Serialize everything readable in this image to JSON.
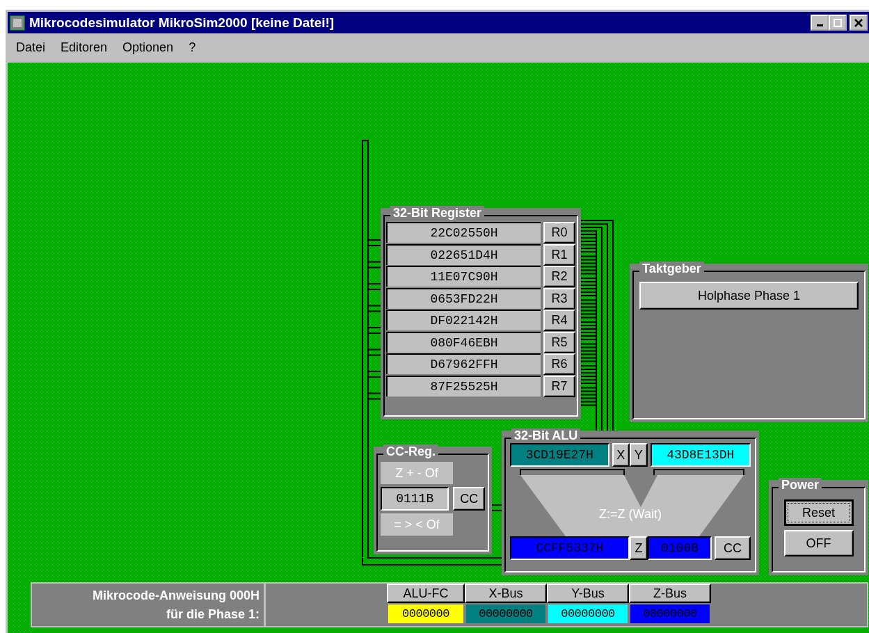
{
  "window": {
    "title": "Mikrocodesimulator MikroSim2000 [keine Datei!]"
  },
  "menu": [
    {
      "label": "Datei"
    },
    {
      "label": "Editoren"
    },
    {
      "label": "Optionen"
    },
    {
      "label": "?"
    }
  ],
  "registers": {
    "title": "32-Bit Register",
    "rows": [
      {
        "value": "22C02550H",
        "label": "R0"
      },
      {
        "value": "022651D4H",
        "label": "R1"
      },
      {
        "value": "11E07C90H",
        "label": "R2"
      },
      {
        "value": "0653FD22H",
        "label": "R3"
      },
      {
        "value": "DF022142H",
        "label": "R4"
      },
      {
        "value": "080F46EBH",
        "label": "R5"
      },
      {
        "value": "D67962FFH",
        "label": "R6"
      },
      {
        "value": "87F25525H",
        "label": "R7"
      }
    ]
  },
  "clock": {
    "title": "Taktgeber",
    "button": "Holphase Phase 1"
  },
  "cc_reg": {
    "title": "CC-Reg.",
    "flags_top": "Z + - Of",
    "value": "0111B",
    "button": "CC",
    "flags_bottom": "= > < Of"
  },
  "alu": {
    "title": "32-Bit ALU",
    "x_value": {
      "text": "3CD19E27H",
      "color": "#008080"
    },
    "x_button": "X",
    "y_button": "Y",
    "y_value": {
      "text": "43D8E13DH",
      "color": "#00ffff"
    },
    "operation": "Z:=Z (Wait)",
    "z_value": {
      "text": "CCFF5337H",
      "color": "#0000ff"
    },
    "z_button": "Z",
    "cc_value": {
      "text": "0100B",
      "color": "#0000ff"
    },
    "cc_button": "CC"
  },
  "power": {
    "title": "Power",
    "buttons": [
      {
        "label": "Reset",
        "focused": true
      },
      {
        "label": "OFF",
        "focused": false
      }
    ]
  },
  "microcode": {
    "lines": [
      "Mikrocode-Anweisung 000H",
      "für die Phase 1:"
    ],
    "columns": [
      {
        "header": "ALU-FC",
        "value": "0000000",
        "color": "#ffff00"
      },
      {
        "header": "X-Bus",
        "value": "00000000",
        "color": "#008080"
      },
      {
        "header": "Y-Bus",
        "value": "00000000",
        "color": "#00ffff"
      },
      {
        "header": "Z-Bus",
        "value": "00000000",
        "color": "#0000ff"
      }
    ]
  }
}
